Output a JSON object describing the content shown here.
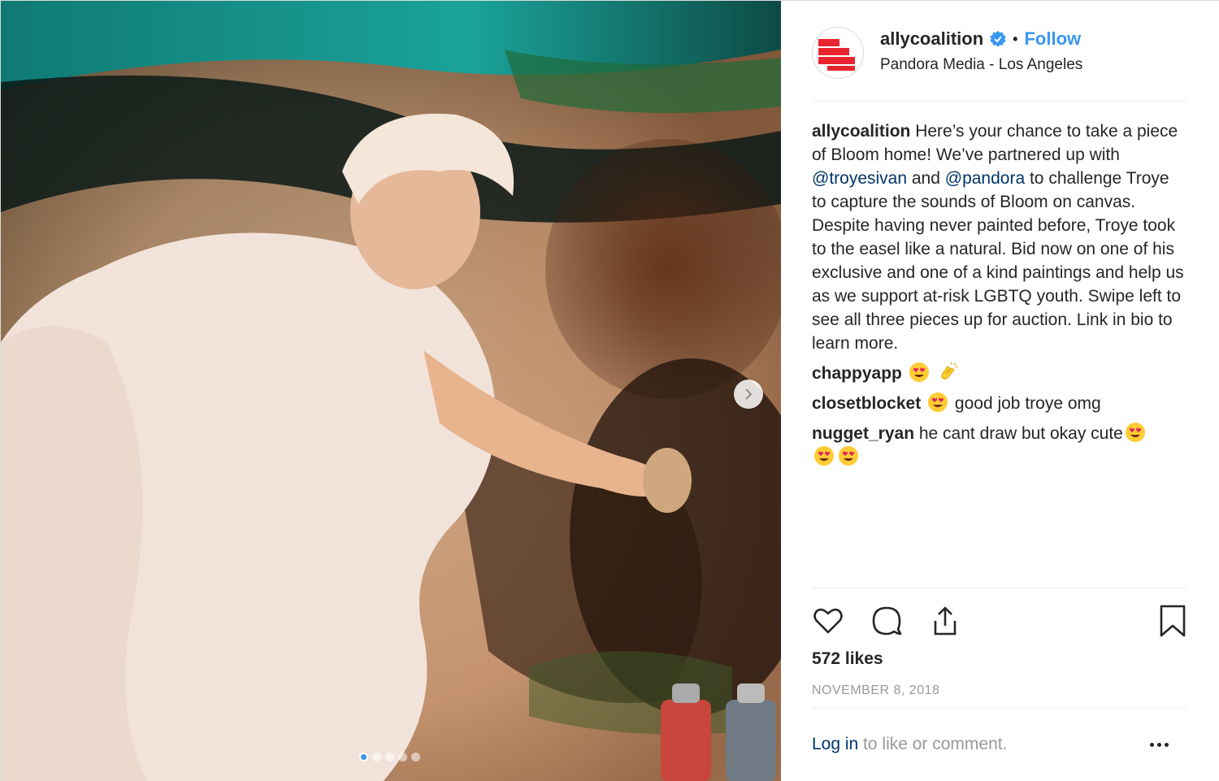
{
  "account": {
    "username": "allycoalition",
    "follow_label": "Follow",
    "separator": "•",
    "location": "Pandora Media - Los Angeles"
  },
  "caption": {
    "user": "allycoalition",
    "text_1": " Here’s your chance to take a piece of Bloom home! We’ve partnered up with ",
    "mention_1": "@troyesivan",
    "text_2": " and ",
    "mention_2": "@pandora",
    "text_3": " to challenge Troye to capture the sounds of Bloom on canvas. Despite having never painted before, Troye took to the easel like a natural. Bid now on one of his exclusive and one of a kind paintings and help us as we support at-risk LGBTQ youth. Swipe left to see all three pieces up for auction. Link in bio to learn more."
  },
  "comments": [
    {
      "user": "chappyapp",
      "text": ""
    },
    {
      "user": "closetblocket",
      "text": " good job troye omg"
    },
    {
      "user": "nugget_ryan",
      "text": " he cant draw but okay cute"
    }
  ],
  "likes": "572 likes",
  "date": "NOVEMBER 8, 2018",
  "login": {
    "link": "Log in",
    "text": " to like or comment."
  },
  "carousel": {
    "total": 5,
    "current": 1
  },
  "icons": {
    "like": "heart-icon",
    "comment": "comment-icon",
    "share": "share-icon",
    "save": "bookmark-icon",
    "more": "more-icon",
    "next": "chevron-right-icon",
    "verified": "verified-badge-icon"
  },
  "colors": {
    "link": "#3897f0",
    "mention": "#003569",
    "brand_red": "#e8252f"
  }
}
